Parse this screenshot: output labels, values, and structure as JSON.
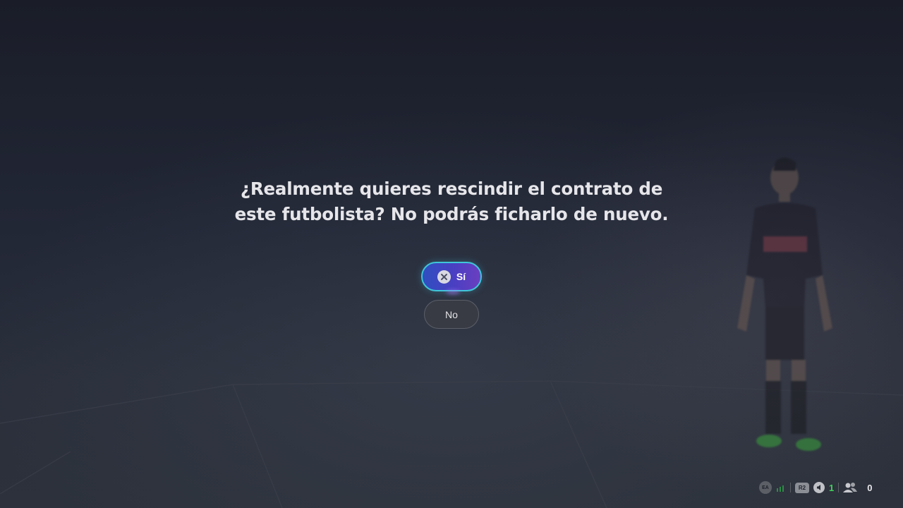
{
  "dialog": {
    "question_line1": "¿Realmente quieres rescindir el contrato de",
    "question_line2": "este futbolista? No podrás ficharlo de nuevo.",
    "yes_label": "Sí",
    "no_label": "No"
  },
  "status_bar": {
    "ea_label": "EA",
    "r2_label": "R2",
    "voice_count": "1",
    "party_count": "0"
  },
  "colors": {
    "accent_border": "#3fc6d8",
    "accent_gradient_start": "#2f4fc0",
    "accent_gradient_end": "#6b3fc0",
    "voice_count_color": "#3fd35a"
  }
}
